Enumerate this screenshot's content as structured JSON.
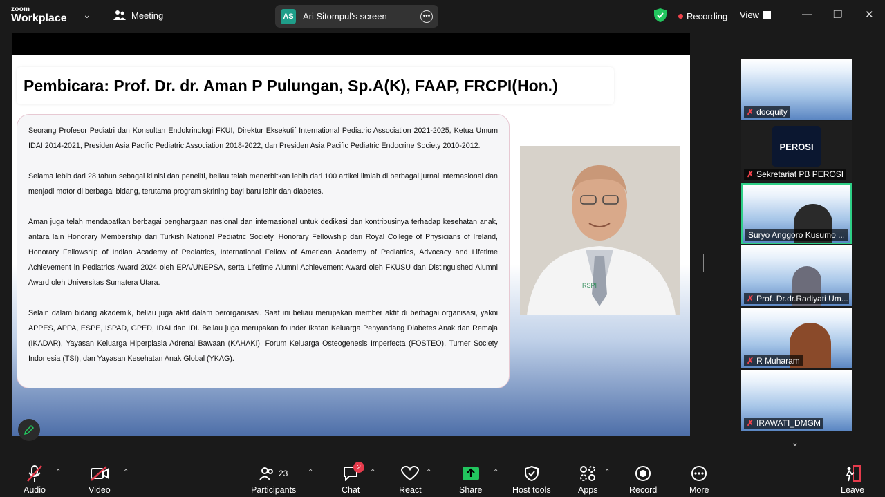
{
  "app": {
    "brand_top": "zoom",
    "brand_bottom": "Workplace",
    "meeting_label": "Meeting"
  },
  "share": {
    "initials": "AS",
    "label": "Ari Sitompul's screen"
  },
  "status": {
    "recording": "Recording",
    "view": "View"
  },
  "slide": {
    "title": "Pembicara: Prof. Dr. dr. Aman P Pulungan, Sp.A(K), FAAP, FRCPI(Hon.)",
    "paragraphs": [
      "Seorang Profesor Pediatri dan Konsultan Endokrinologi FKUI, Direktur Eksekutif International Pediatric Association 2021-2025, Ketua Umum IDAI 2014-2021, Presiden Asia Pacific Pediatric Association 2018-2022, dan Presiden Asia Pacific Pediatric Endocrine Society 2010-2012.",
      "Selama lebih dari 28 tahun sebagai klinisi dan peneliti, beliau telah menerbitkan lebih dari 100 artikel ilmiah di berbagai jurnal internasional dan menjadi motor di berbagai bidang, terutama program skrining bayi baru lahir dan diabetes.",
      "Aman juga telah mendapatkan berbagai penghargaan nasional dan internasional untuk dedikasi dan kontribusinya terhadap kesehatan anak, antara lain Honorary Membership dari Turkish National Pediatric Society, Honorary Fellowship dari Royal College of Physicians of Ireland, Honorary Fellowship of Indian Academy of Pediatrics, International Fellow of American Academy of Pediatrics, Advocacy and Lifetime Achievement in Pediatrics Award 2024 oleh EPA/UNEPSA, serta Lifetime Alumni Achievement Award  oleh FKUSU dan Distinguished Alumni Award oleh Universitas Sumatera Utara.",
      "Selain dalam bidang akademik, beliau juga aktif dalam berorganisasi. Saat ini beliau merupakan member aktif di berbagai organisasi, yakni APPES, APPA, ESPE, ISPAD, GPED, IDAI dan IDI. Beliau juga merupakan founder Ikatan Keluarga Penyandang Diabetes Anak dan Remaja (IKADAR), Yayasan Keluarga Hiperplasia Adrenal Bawaan (KAHAKI), Forum Keluarga Osteogenesis Imperfecta (FOSTEO), Turner Society Indonesia (TSI), dan Yayasan Kesehatan Anak Global (YKAG)."
    ],
    "photo_logo": "RSPI"
  },
  "participants": [
    {
      "name": "docquity",
      "kind": "slide"
    },
    {
      "name": "Sekretariat PB PEROSI",
      "kind": "logo",
      "logo_text": "PEROSI"
    },
    {
      "name": "Suryo Anggoro Kusumo ...",
      "kind": "person",
      "active": true
    },
    {
      "name": "Prof. Dr.dr.Radiyati Um...",
      "kind": "person"
    },
    {
      "name": "R Muharam",
      "kind": "person"
    },
    {
      "name": "IRAWATI_DMGM",
      "kind": "banner"
    }
  ],
  "toolbar": {
    "audio": "Audio",
    "video": "Video",
    "participants": "Participants",
    "participants_count": "23",
    "chat": "Chat",
    "chat_badge": "2",
    "react": "React",
    "share": "Share",
    "host_tools": "Host tools",
    "apps": "Apps",
    "record": "Record",
    "more": "More",
    "leave": "Leave"
  },
  "colors": {
    "recording_dot": "#f0424b",
    "share_green": "#22c55e",
    "active_border": "#2ecf86",
    "leave_red": "#e53b4c"
  }
}
